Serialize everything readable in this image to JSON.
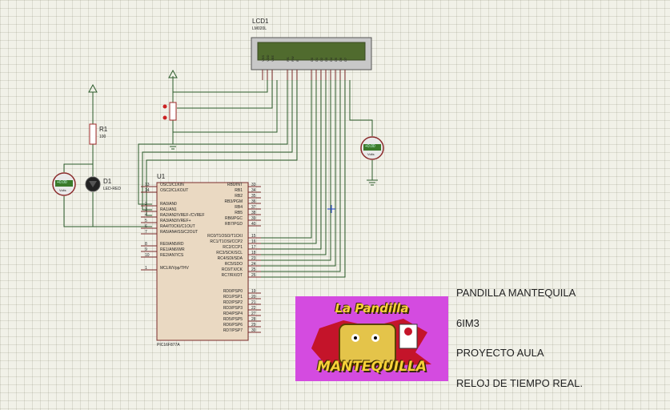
{
  "lcd": {
    "ref": "LCD1",
    "model": "LM020L",
    "pins": [
      "VSS",
      "VDD",
      "VEE",
      "RS",
      "RW",
      "E",
      "D0",
      "D1",
      "D2",
      "D3",
      "D4",
      "D5",
      "D6",
      "D7"
    ]
  },
  "resistor": {
    "ref": "R1",
    "value": "100"
  },
  "diode": {
    "ref": "D1",
    "model": "LED-RED"
  },
  "voltmeter_left": {
    "reading": "+0.00",
    "unit": "Volts"
  },
  "voltmeter_right": {
    "reading": "+0.00",
    "unit": "Volts"
  },
  "mcu": {
    "ref": "U1",
    "model": "PIC16F877A",
    "left_pins": [
      {
        "num": "13",
        "name": "OSC1/CLKIN"
      },
      {
        "num": "14",
        "name": "OSC2/CLKOUT"
      },
      {
        "num": "2",
        "name": "RA0/AN0"
      },
      {
        "num": "3",
        "name": "RA1/AN1"
      },
      {
        "num": "4",
        "name": "RA2/AN2/VREF-/CVREF"
      },
      {
        "num": "5",
        "name": "RA3/AN3/VREF+"
      },
      {
        "num": "6",
        "name": "RA4/T0CKI/C1OUT"
      },
      {
        "num": "7",
        "name": "RA5/AN4/SS/C2OUT"
      },
      {
        "num": "8",
        "name": "RE0/AN5/RD"
      },
      {
        "num": "9",
        "name": "RE1/AN6/WR"
      },
      {
        "num": "10",
        "name": "RE2/AN7/CS"
      },
      {
        "num": "1",
        "name": "MCLR/Vpp/THV"
      }
    ],
    "right_pins": [
      {
        "num": "33",
        "name": "RB0/INT"
      },
      {
        "num": "34",
        "name": "RB1"
      },
      {
        "num": "35",
        "name": "RB2"
      },
      {
        "num": "36",
        "name": "RB3/PGM"
      },
      {
        "num": "37",
        "name": "RB4"
      },
      {
        "num": "38",
        "name": "RB5"
      },
      {
        "num": "39",
        "name": "RB6/PGC"
      },
      {
        "num": "40",
        "name": "RB7/PGD"
      },
      {
        "num": "15",
        "name": "RC0/T1OSO/T1CKI"
      },
      {
        "num": "16",
        "name": "RC1/T1OSI/CCP2"
      },
      {
        "num": "17",
        "name": "RC2/CCP1"
      },
      {
        "num": "18",
        "name": "RC3/SCK/SCL"
      },
      {
        "num": "23",
        "name": "RC4/SDI/SDA"
      },
      {
        "num": "24",
        "name": "RC5/SDO"
      },
      {
        "num": "25",
        "name": "RC6/TX/CK"
      },
      {
        "num": "26",
        "name": "RC7/RX/DT"
      },
      {
        "num": "19",
        "name": "RD0/PSP0"
      },
      {
        "num": "20",
        "name": "RD1/PSP1"
      },
      {
        "num": "21",
        "name": "RD2/PSP2"
      },
      {
        "num": "22",
        "name": "RD3/PSP3"
      },
      {
        "num": "27",
        "name": "RD4/PSP4"
      },
      {
        "num": "28",
        "name": "RD5/PSP5"
      },
      {
        "num": "29",
        "name": "RD6/PSP6"
      },
      {
        "num": "30",
        "name": "RD7/PSP7"
      }
    ]
  },
  "logo": {
    "top_text": "La Pandilla",
    "bottom_text": "MANTEQUILLA",
    "background": "#d44be0"
  },
  "side_texts": {
    "line1": "PANDILLA MANTEQUILA",
    "line2": "6IM3",
    "line3": "PROYECTO AULA",
    "line4": "RELOJ DE TIEMPO REAL."
  },
  "colors": {
    "wire": "#2a5a2a",
    "component": "#a22b2b",
    "body": "#ead9c2",
    "pin": "#7a2a2a"
  }
}
